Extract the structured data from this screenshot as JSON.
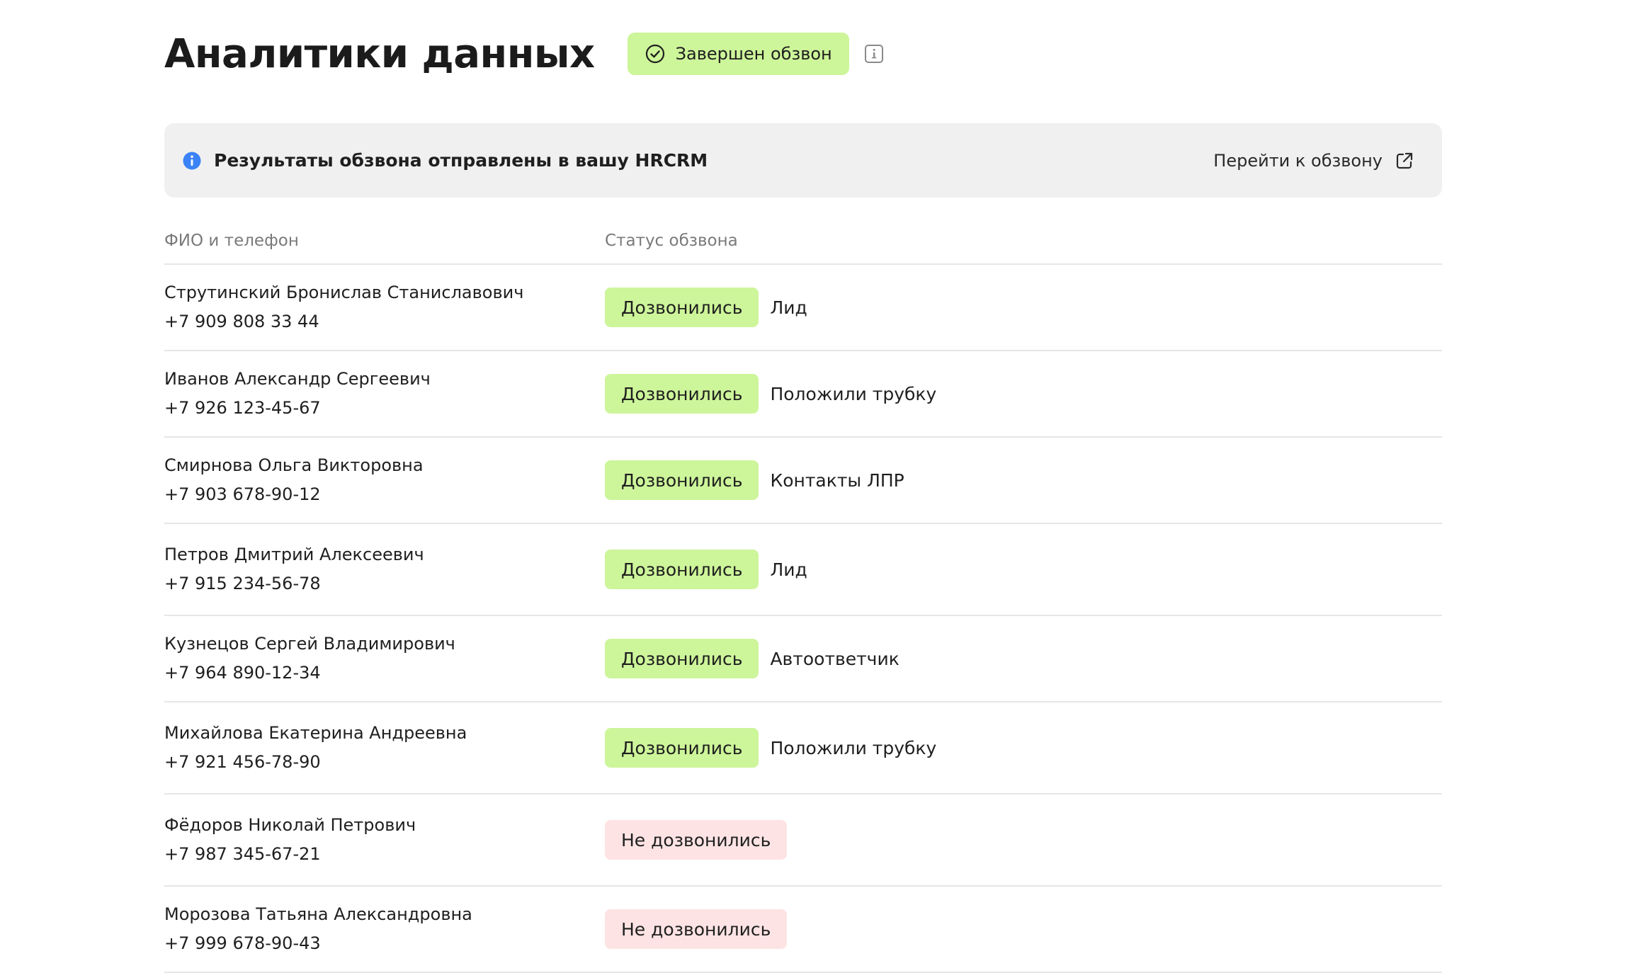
{
  "header": {
    "title": "Аналитики данных",
    "status_chip": "Завершен обзвон",
    "status_chip_icon": "check-circle-icon",
    "info_icon": "info-square-icon"
  },
  "banner": {
    "text": "Результаты обзвона отправлены в вашу HRCRM",
    "icon": "info-circle-icon",
    "link_label": "Перейти к обзвону",
    "link_icon": "external-link-icon",
    "accent_color": "#3b82f6"
  },
  "table": {
    "columns": {
      "name": "ФИО и телефон",
      "status": "Статус обзвона"
    },
    "rows": [
      {
        "name": "Струтинский Бронислав Станиславович",
        "phone": "+7 909 808 33 44",
        "status": "Дозвонились",
        "status_type": "ok",
        "result": "Лид"
      },
      {
        "name": "Иванов Александр Сергеевич",
        "phone": "+7 926 123-45-67",
        "status": "Дозвонились",
        "status_type": "ok",
        "result": "Положили трубку"
      },
      {
        "name": "Смирнова Ольга Викторовна",
        "phone": "+7 903 678-90-12",
        "status": "Дозвонились",
        "status_type": "ok",
        "result": "Контакты ЛПР"
      },
      {
        "name": "Петров Дмитрий Алексеевич",
        "phone": "+7 915 234-56-78",
        "status": "Дозвонились",
        "status_type": "ok",
        "result": "Лид"
      },
      {
        "name": "Кузнецов Сергей Владимирович",
        "phone": "+7 964 890-12-34",
        "status": "Дозвонились",
        "status_type": "ok",
        "result": "Автоответчик"
      },
      {
        "name": "Михайлова Екатерина Андреевна",
        "phone": "+7 921 456-78-90",
        "status": "Дозвонились",
        "status_type": "ok",
        "result": "Положили трубку"
      },
      {
        "name": "Фёдоров Николай Петрович",
        "phone": "+7 987 345-67-21",
        "status": "Не дозвонились",
        "status_type": "fail",
        "result": ""
      },
      {
        "name": "Морозова Татьяна Александровна",
        "phone": "+7 999 678-90-43",
        "status": "Не дозвонились",
        "status_type": "fail",
        "result": ""
      }
    ]
  },
  "colors": {
    "success_badge": "#cdf59a",
    "fail_badge": "#fde3e3",
    "banner_bg": "#f0f0f0",
    "divider": "#e6e6e6"
  }
}
